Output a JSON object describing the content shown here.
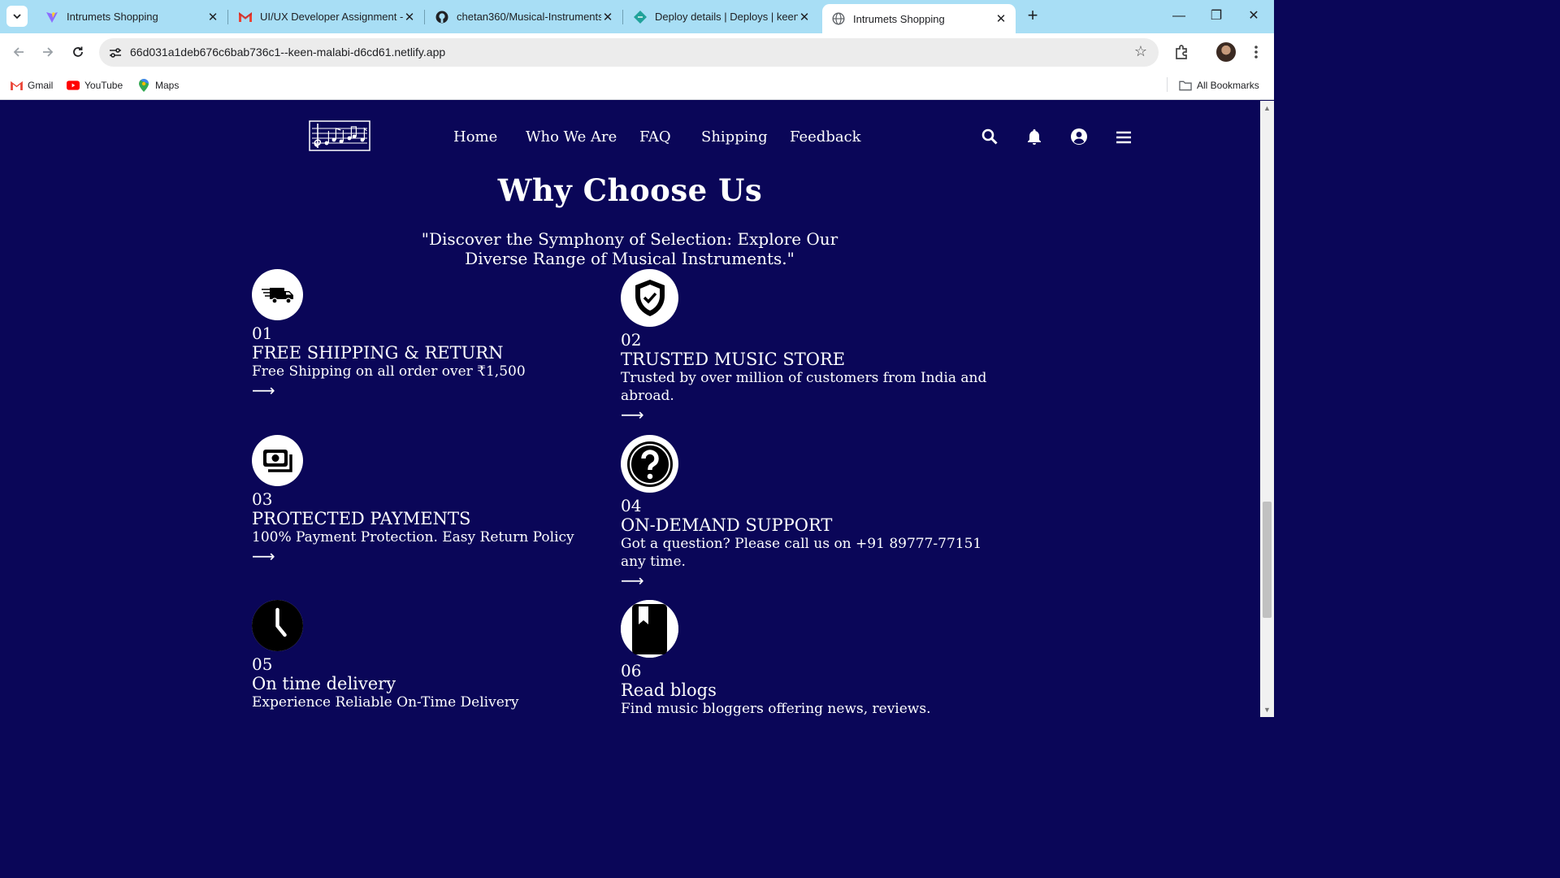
{
  "browser": {
    "tabs": [
      {
        "title": "Intrumets Shopping",
        "favicon": "vite-icon",
        "active": false
      },
      {
        "title": "UI/UX Developer Assignment -",
        "favicon": "gmail-icon",
        "active": false
      },
      {
        "title": "chetan360/Musical-Instruments",
        "favicon": "github-icon",
        "active": false
      },
      {
        "title": "Deploy details | Deploys | keen-",
        "favicon": "netlify-icon",
        "active": false
      },
      {
        "title": "Intrumets Shopping",
        "favicon": "globe-icon",
        "active": true
      }
    ],
    "url": "66d031a1deb676c6bab736c1--keen-malabi-d6cd61.netlify.app",
    "bookmarks": [
      {
        "label": "Gmail",
        "icon": "gmail-icon"
      },
      {
        "label": "YouTube",
        "icon": "youtube-icon"
      },
      {
        "label": "Maps",
        "icon": "maps-icon"
      }
    ],
    "all_bookmarks": "All Bookmarks"
  },
  "site": {
    "nav": [
      "Home",
      "Who We Are",
      "FAQ",
      "Shipping",
      "Feedback"
    ],
    "section_title": "Why Choose Us",
    "tagline": "\"Discover the Symphony of Selection: Explore Our Diverse Range of Musical Instruments.\"",
    "arrow": "⟶",
    "features": [
      {
        "num": "01",
        "title": "FREE SHIPPING & RETURN",
        "desc": "Free Shipping on all order over ₹1,500",
        "icon": "truck-icon"
      },
      {
        "num": "02",
        "title": "TRUSTED MUSIC STORE",
        "desc": "Trusted by over million of customers from India and abroad.",
        "icon": "shield-check-icon"
      },
      {
        "num": "03",
        "title": "PROTECTED PAYMENTS",
        "desc": "100% Payment Protection. Easy Return Policy",
        "icon": "money-icon"
      },
      {
        "num": "04",
        "title": "ON-DEMAND SUPPORT",
        "desc": "Got a question? Please call us on +91 89777-77151 any time.",
        "icon": "question-icon"
      },
      {
        "num": "05",
        "title": "On time delivery",
        "desc": "Experience Reliable On-Time Delivery",
        "icon": "clock-icon"
      },
      {
        "num": "06",
        "title": "Read blogs",
        "desc": "Find music bloggers offering news, reviews.",
        "icon": "book-icon"
      }
    ]
  },
  "colors": {
    "page_bg": "#0a0658",
    "tabbar_bg": "#a8def5",
    "text": "#ffffff"
  }
}
